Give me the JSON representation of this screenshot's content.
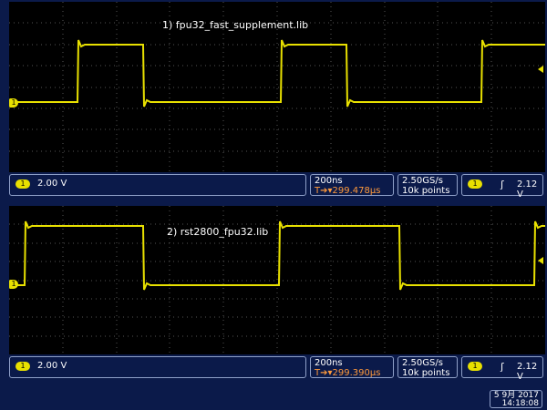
{
  "scope1": {
    "title": "1) fpu32_fast_supplement.lib",
    "channel_marker": "1",
    "volts_div": "2.00 V",
    "timebase": "200ns",
    "delay": "299.478μs",
    "sample_rate": "2.50GS/s",
    "record_length": "10k points",
    "trigger_channel": "1",
    "trigger_edge": "ʃ",
    "trigger_level": "2.12 V"
  },
  "scope2": {
    "title": "2) rst2800_fpu32.lib",
    "channel_marker": "1",
    "volts_div": "2.00 V",
    "timebase": "200ns",
    "delay": "299.390μs",
    "sample_rate": "2.50GS/s",
    "record_length": "10k points",
    "trigger_channel": "1",
    "trigger_edge": "ʃ",
    "trigger_level": "2.12 V"
  },
  "datetime": {
    "date": "5 9月  2017",
    "time": "14:18:08"
  },
  "colors": {
    "trace": "#e8e000",
    "background": "#000000",
    "frame": "#0b1a4a"
  }
}
